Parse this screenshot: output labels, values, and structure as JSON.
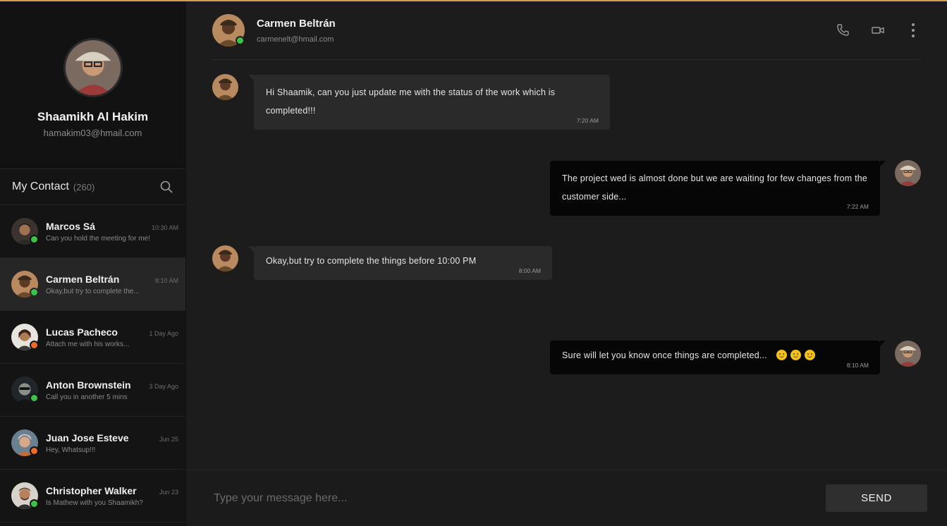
{
  "colors": {
    "online": "#3ec24a",
    "away": "#f06a2a",
    "accent_top": "#c9a24a"
  },
  "user": {
    "name": "Shaamikh Al Hakim",
    "email": "hamakim03@hmail.com"
  },
  "contacts_header": {
    "title": "My Contact",
    "count": "(260)"
  },
  "contacts": [
    {
      "name": "Marcos Sá",
      "time": "10:30 AM",
      "preview": "Can you hold the meeting for me!",
      "status": "online"
    },
    {
      "name": "Carmen Beltrán",
      "time": "8:10 AM",
      "preview": "Okay,but try to complete the...",
      "status": "online"
    },
    {
      "name": "Lucas Pacheco",
      "time": "1 Day Ago",
      "preview": "Attach me with his works...",
      "status": "away"
    },
    {
      "name": "Anton Brownstein",
      "time": "3 Day Ago",
      "preview": "Call you in another 5 mins",
      "status": "online"
    },
    {
      "name": "Juan Jose Esteve",
      "time": "Jun 25",
      "preview": "Hey, Whatsup!!!",
      "status": "away"
    },
    {
      "name": "Christopher Walker",
      "time": "Jun 23",
      "preview": "Is Mathew with you Shaamikh?",
      "status": "online"
    }
  ],
  "chat": {
    "name": "Carmen Beltrán",
    "email": "carmenelt@hmail.com"
  },
  "messages": [
    {
      "direction": "in",
      "text": "Hi Shaamik, can you just update me with the status of the work which is completed!!!",
      "time": "7:20 AM"
    },
    {
      "direction": "out",
      "text": "The project wed is almost done but we are waiting for few changes from the customer side...",
      "time": "7:22 AM"
    },
    {
      "direction": "in",
      "text": "Okay,but try to complete the things before 10:00 PM",
      "time": "8:00 AM"
    },
    {
      "direction": "out",
      "text": "Sure will let you know once things are completed...",
      "time": "8:10 AM",
      "emoji_count": 3
    }
  ],
  "composer": {
    "placeholder": "Type your message here...",
    "send_label": "SEND"
  }
}
